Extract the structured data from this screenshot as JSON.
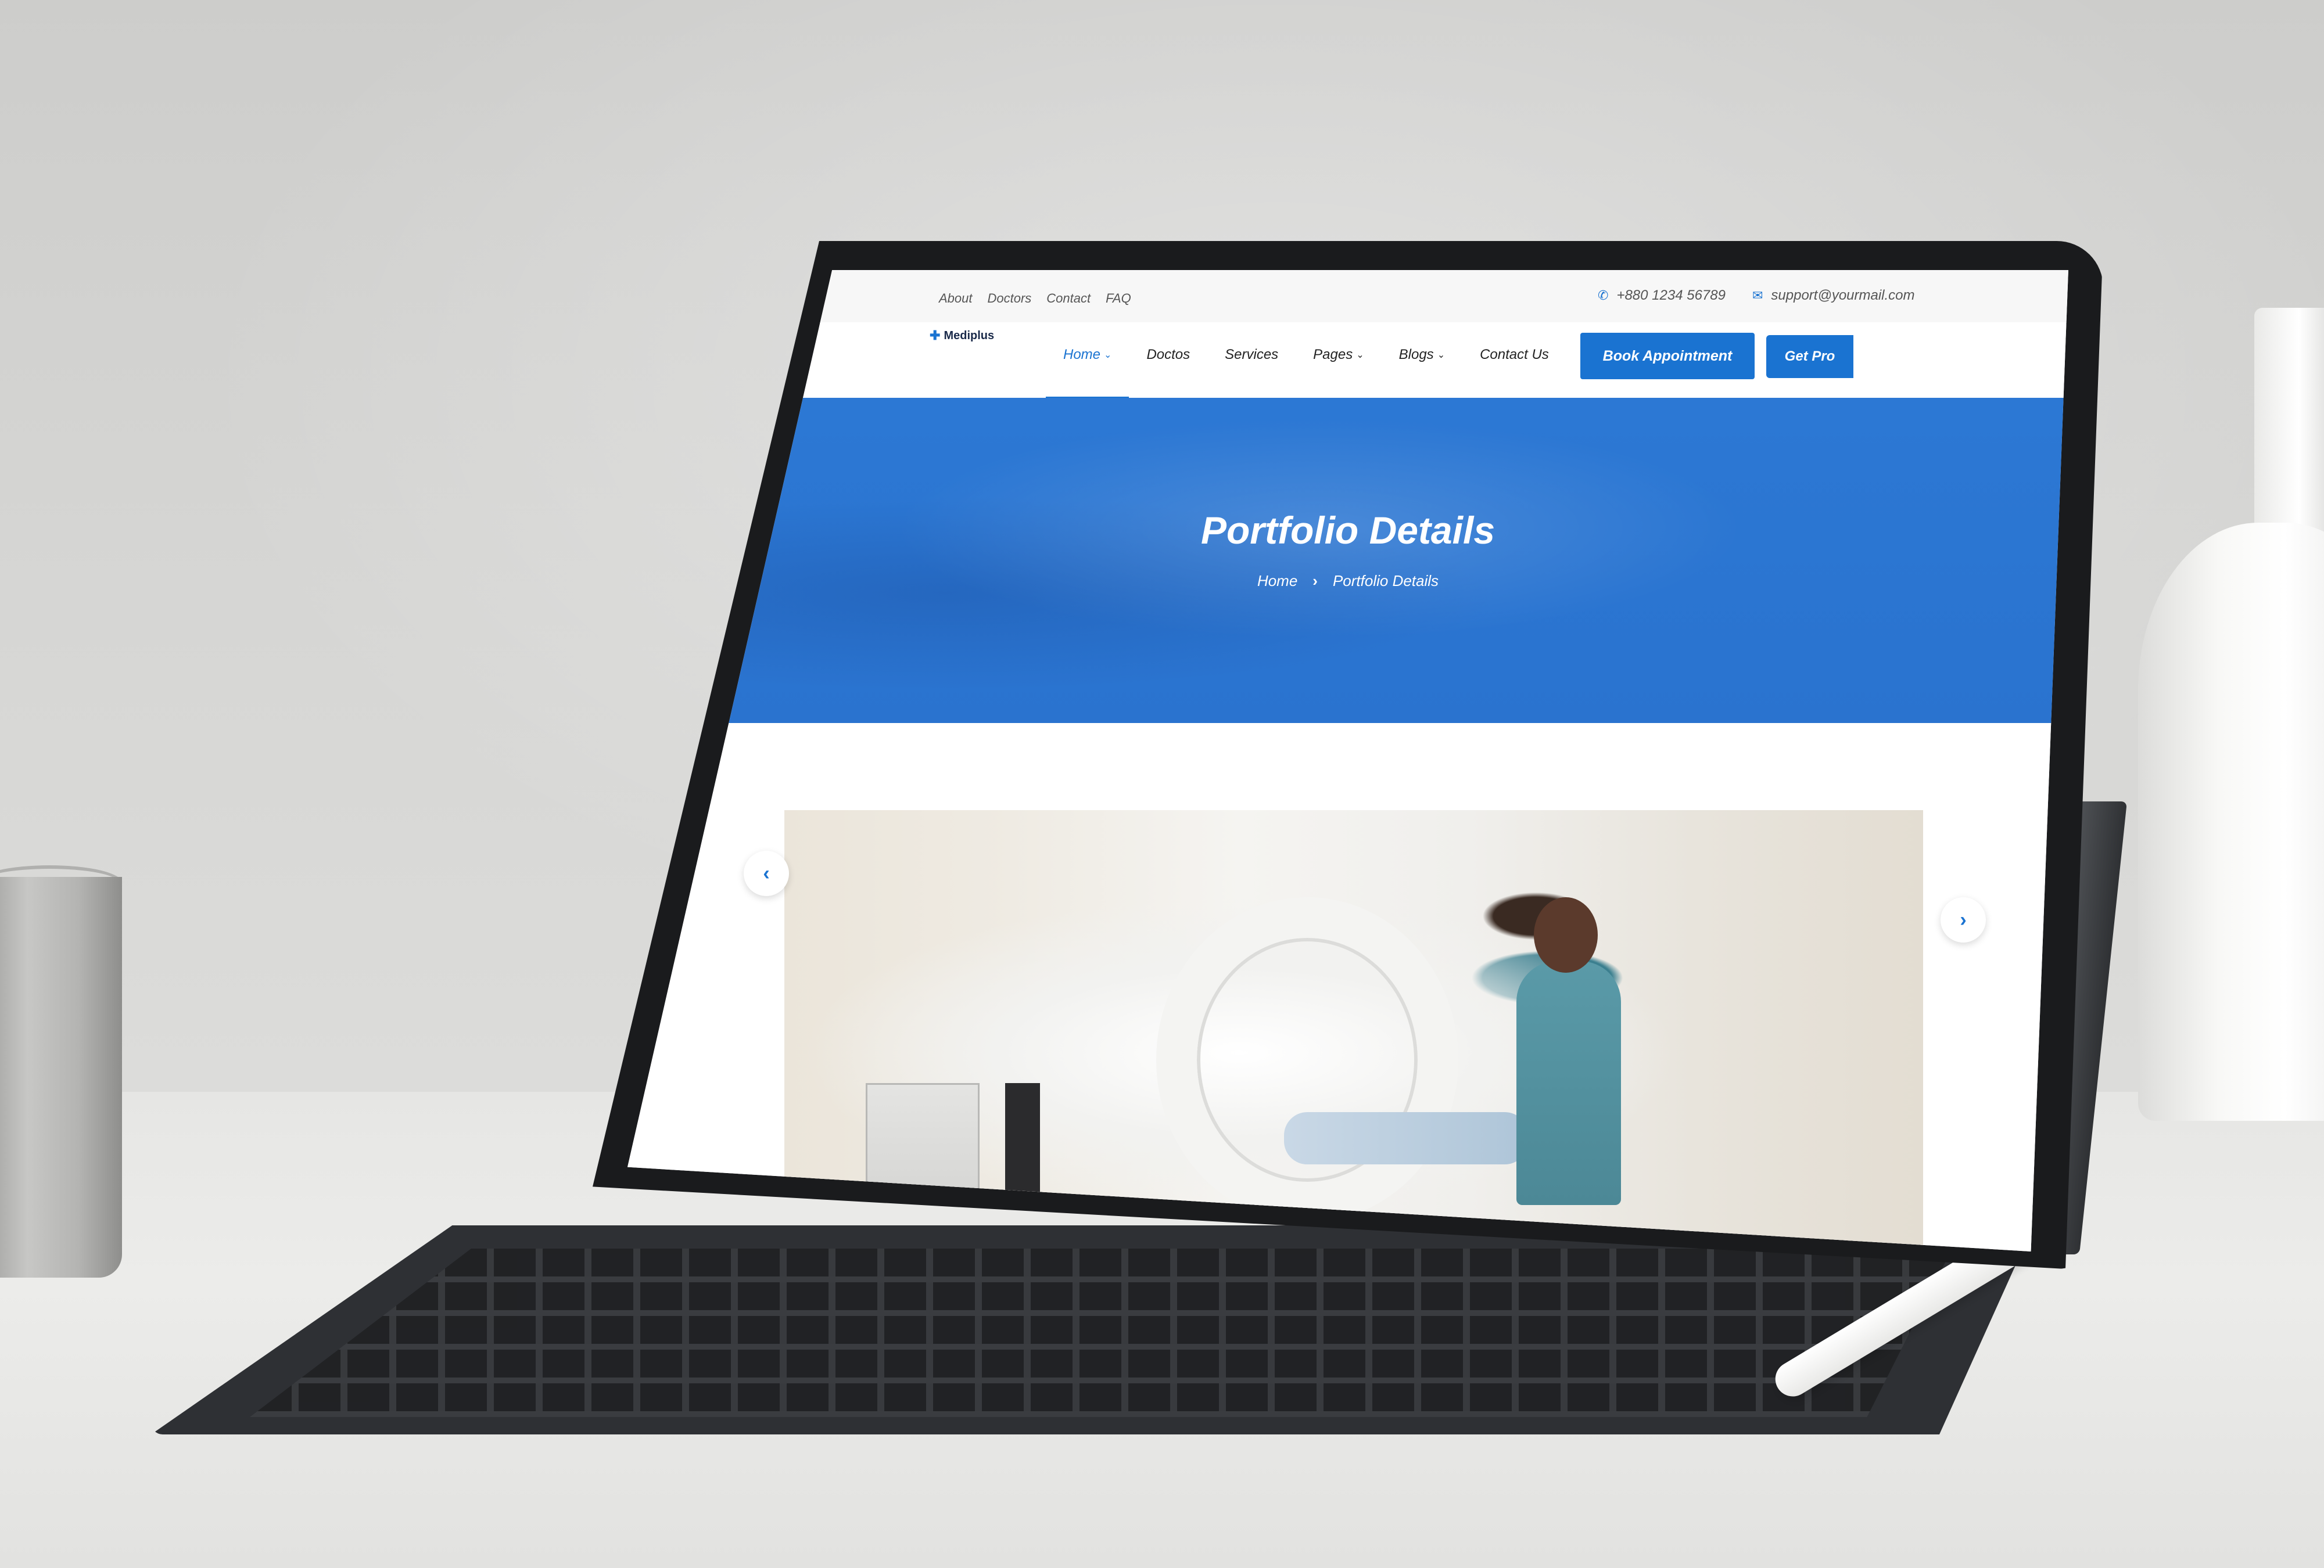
{
  "topbar": {
    "links": [
      "About",
      "Doctors",
      "Contact",
      "FAQ"
    ],
    "phone": "+880 1234 56789",
    "email": "support@yourmail.com"
  },
  "brand": {
    "name": "Mediplus"
  },
  "nav": {
    "items": [
      {
        "label": "Home",
        "dropdown": true,
        "active": true
      },
      {
        "label": "Doctos",
        "dropdown": false
      },
      {
        "label": "Services",
        "dropdown": false
      },
      {
        "label": "Pages",
        "dropdown": true
      },
      {
        "label": "Blogs",
        "dropdown": true
      },
      {
        "label": "Contact Us",
        "dropdown": false
      }
    ],
    "cta": "Book Appointment",
    "get_pro": "Get Pro"
  },
  "hero": {
    "title": "Portfolio Details",
    "breadcrumb": [
      "Home",
      "Portfolio Details"
    ]
  },
  "slider": {
    "prev_icon": "chevron-left-icon",
    "next_icon": "chevron-right-icon"
  },
  "colors": {
    "accent": "#1a73d1",
    "hero": "#2a73cf"
  }
}
